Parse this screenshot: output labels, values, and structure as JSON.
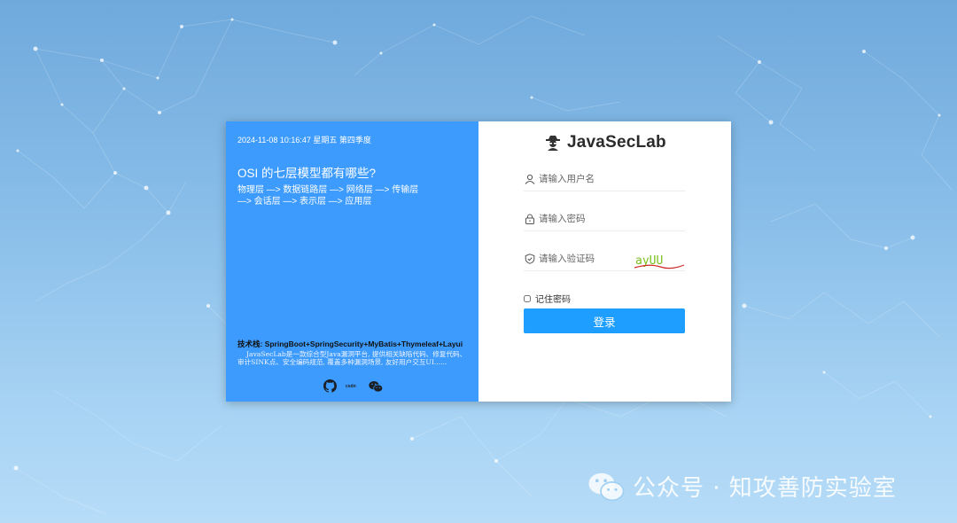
{
  "left_panel": {
    "datetime": "2024-11-08 10:16:47 星期五 第四季度",
    "question": "OSI 的七层模型都有哪些?",
    "answer_line1": "物理层 —> 数据链路层 —> 网络层 —> 传输层",
    "answer_line2": "—> 会话层 —> 表示层 —> 应用层",
    "tech_stack": "技术栈: SpringBoot+SpringSecurity+MyBatis+Thymeleaf+Layui",
    "description": "JavaSecLab是一款综合型Java漏洞平台, 提供相关缺陷代码、修复代码、审计SINK点、安全编码规范, 覆盖多种漏洞场景, 友好用户交互UI......",
    "social": {
      "csdn_label": "csdn"
    }
  },
  "login": {
    "logo_text": "JavaSecLab",
    "username_placeholder": "请输入用户名",
    "password_placeholder": "请输入密码",
    "captcha_placeholder": "请输入验证码",
    "captcha_text": "ayUU",
    "remember_label": "记住密码",
    "submit_label": "登录"
  },
  "watermark": {
    "text": "公众号 · 知攻善防实验室"
  },
  "colors": {
    "left_panel": "#3d9bfd",
    "button": "#1e9fff"
  }
}
